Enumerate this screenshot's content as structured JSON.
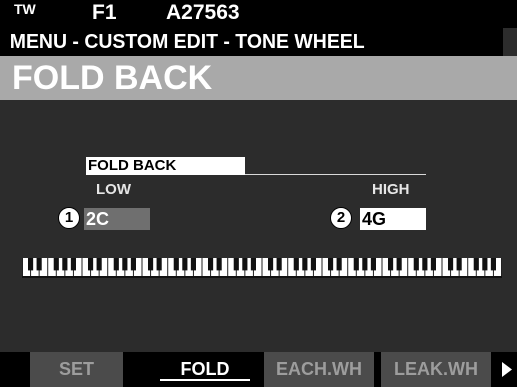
{
  "status": {
    "mode": "TW",
    "patch": "F1",
    "name": "A27563"
  },
  "breadcrumb": "MENU - CUSTOM EDIT - TONE WHEEL",
  "page_title": "FOLD BACK",
  "section": {
    "label": "FOLD BACK"
  },
  "low": {
    "label": "LOW",
    "value": "2C",
    "marker": "1"
  },
  "high": {
    "label": "HIGH",
    "value": "4G",
    "marker": "2"
  },
  "tabs": [
    {
      "label": "SET",
      "active": false
    },
    {
      "label": "FOLD",
      "active": true
    },
    {
      "label": "EACH.WH",
      "active": false
    },
    {
      "label": "LEAK.WH",
      "active": false
    }
  ],
  "keyboard": {
    "octaves": 8
  },
  "colors": {
    "screen": "#2c2c2c",
    "title_bar": "#a9a9a9",
    "tab_inactive": "#4b4b4b",
    "low_field": "#6f6f6f"
  }
}
